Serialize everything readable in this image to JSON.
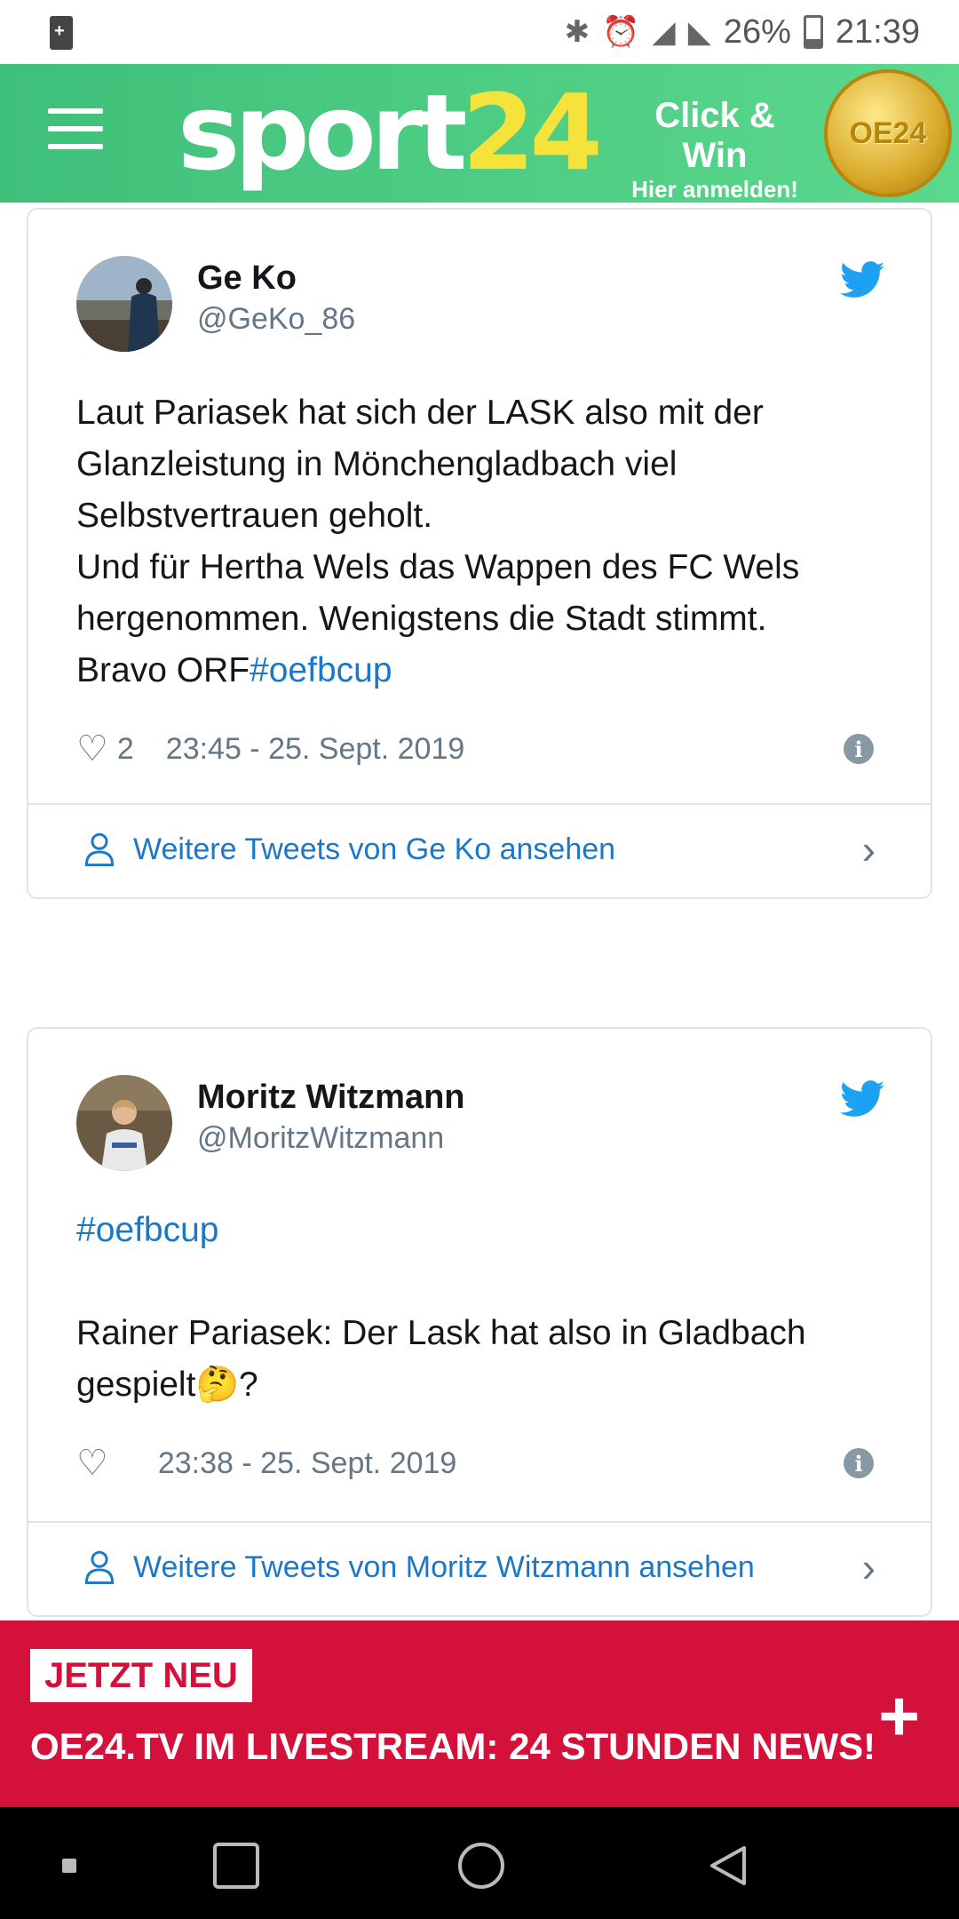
{
  "status_bar": {
    "battery_percent": "26%",
    "time": "21:39"
  },
  "header": {
    "logo_part1": "sport",
    "logo_part2": "24",
    "promo_title": "Click & Win",
    "promo_subtitle": "Hier anmelden!",
    "coin_text": "OE24",
    "colors": {
      "header_bg": "#3fc07a",
      "logo_accent": "#f5e23a"
    }
  },
  "tweets": [
    {
      "name": "Ge Ko",
      "handle": "@GeKo_86",
      "text_lines": [
        "Laut Pariasek hat sich der LASK also mit der",
        "Glanzleistung in Mönchengladbach viel",
        "Selbstvertrauen geholt.",
        "Und für Hertha Wels das Wappen des FC Wels",
        "hergenommen. Wenigstens die Stadt stimmt.",
        "Bravo ORF"
      ],
      "hashtag": "#oefbcup",
      "likes": "2",
      "timestamp": "23:45 - 25. Sept. 2019",
      "more_link": "Weitere Tweets von Ge Ko ansehen"
    },
    {
      "name": "Moritz Witzmann",
      "handle": "@MoritzWitzmann",
      "hashtag": "#oefbcup",
      "text_line1": "Rainer Pariasek: Der Lask hat also in Gladbach",
      "text_line2": "gespielt",
      "emoji": "🤔",
      "text_end": "?",
      "likes": "",
      "timestamp": "23:38 - 25. Sept. 2019",
      "more_link": "Weitere Tweets von Moritz Witzmann ansehen"
    }
  ],
  "banner": {
    "tag": "JETZT NEU",
    "headline": "OE24.TV IM LIVESTREAM: 24 STUNDEN NEWS!",
    "plus": "+",
    "color": "#d3113a"
  }
}
